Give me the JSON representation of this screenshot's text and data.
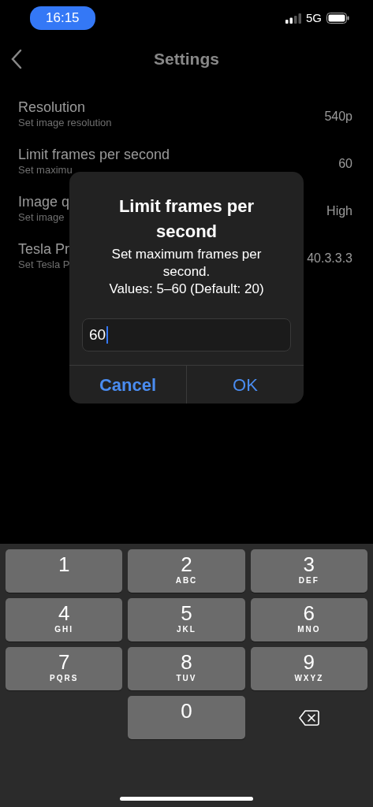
{
  "status_bar": {
    "time": "16:15",
    "network": "5G"
  },
  "nav": {
    "title": "Settings"
  },
  "settings": [
    {
      "title": "Resolution",
      "subtitle": "Set image resolution",
      "value": "540p"
    },
    {
      "title": "Limit frames per second",
      "subtitle": "Set maximu",
      "value": "60"
    },
    {
      "title": "Image q",
      "subtitle": "Set image",
      "value": "High"
    },
    {
      "title": "Tesla Pr",
      "subtitle": "Set Tesla P",
      "value": "40.3.3.3"
    }
  ],
  "dialog": {
    "title": "Limit frames per second",
    "message": "Set maximum frames per second.",
    "hint": "Values: 5–60 (Default: 20)",
    "value": "60",
    "buttons": [
      {
        "label": "Cancel",
        "kind": "cancel"
      },
      {
        "label": "OK",
        "kind": "ok"
      }
    ]
  },
  "keyboard": [
    {
      "kind": "digit",
      "digit": "1"
    },
    {
      "kind": "digit",
      "digit": "2",
      "letters": "ABC"
    },
    {
      "kind": "digit",
      "digit": "3",
      "letters": "DEF"
    },
    {
      "kind": "digit",
      "digit": "4",
      "letters": "GHI"
    },
    {
      "kind": "digit",
      "digit": "5",
      "letters": "JKL"
    },
    {
      "kind": "digit",
      "digit": "6",
      "letters": "MNO"
    },
    {
      "kind": "digit",
      "digit": "7",
      "letters": "PQRS"
    },
    {
      "kind": "digit",
      "digit": "8",
      "letters": "TUV"
    },
    {
      "kind": "digit",
      "digit": "9",
      "letters": "WXYZ"
    },
    {
      "kind": "digit",
      "digit": "0"
    },
    {
      "kind": "delete"
    }
  ]
}
